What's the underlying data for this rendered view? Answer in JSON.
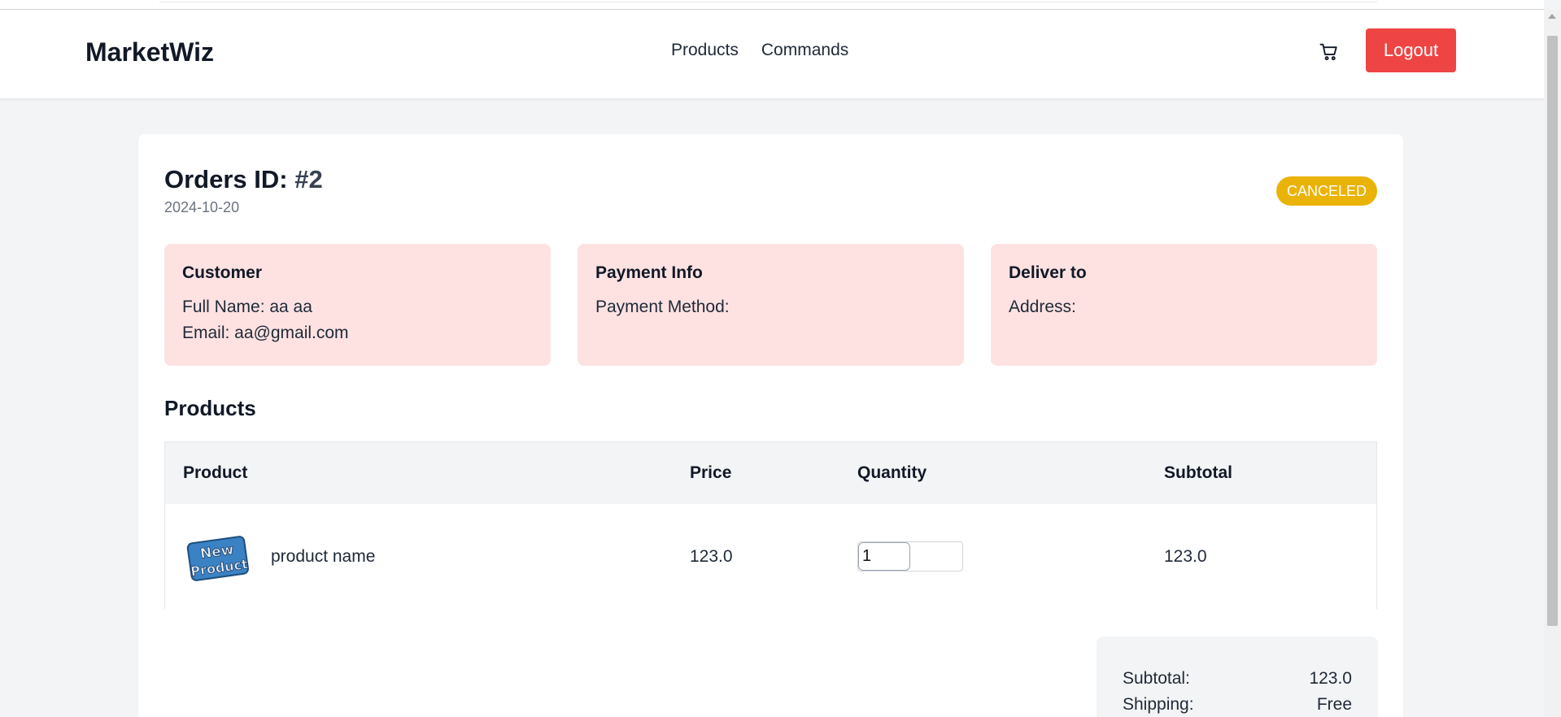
{
  "header": {
    "brand": "MarketWiz",
    "nav": [
      "Products",
      "Commands"
    ],
    "logout_label": "Logout",
    "cart_icon": "cart-icon"
  },
  "order": {
    "title_prefix": "Orders ID:",
    "id": "#2",
    "date": "2024-10-20",
    "status": "CANCELED"
  },
  "customer": {
    "heading": "Customer",
    "full_name": "Full Name: aa aa",
    "email": "Email: aa@gmail.com"
  },
  "payment": {
    "heading": "Payment Info",
    "method": "Payment Method:"
  },
  "delivery": {
    "heading": "Deliver to",
    "address": "Address:"
  },
  "products": {
    "heading": "Products",
    "columns": [
      "Product",
      "Price",
      "Quantity",
      "Subtotal"
    ],
    "rows": [
      {
        "image_text": [
          "New",
          "Product"
        ],
        "name": "product name",
        "price": "123.0",
        "quantity": "1",
        "subtotal": "123.0"
      }
    ]
  },
  "summary": {
    "subtotal_label": "Subtotal:",
    "subtotal_value": "123.0",
    "shipping_label": "Shipping:",
    "shipping_value": "Free"
  },
  "colors": {
    "logout": "#ef4444",
    "status_badge": "#eab308",
    "info_box": "#fee2e2"
  }
}
